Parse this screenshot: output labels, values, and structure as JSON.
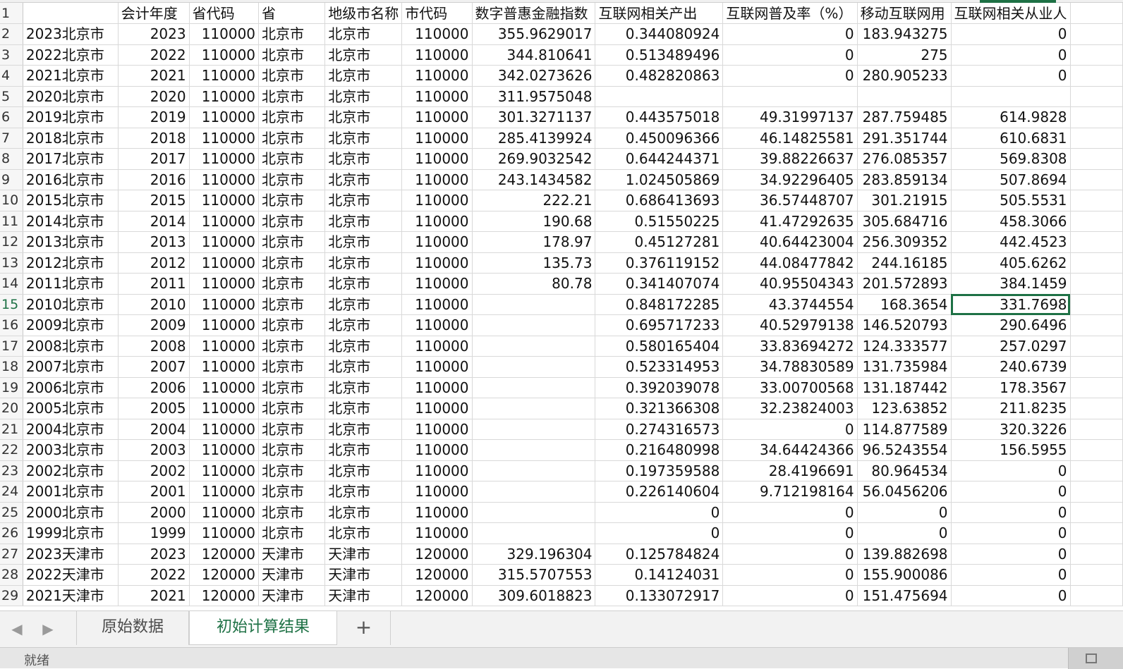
{
  "sheet": {
    "row_numbers": [
      "1",
      "2",
      "3",
      "4",
      "5",
      "6",
      "7",
      "8",
      "9",
      "10",
      "11",
      "12",
      "13",
      "14",
      "15",
      "16",
      "17",
      "18",
      "19",
      "20",
      "21",
      "22",
      "23",
      "24",
      "25",
      "26",
      "27",
      "28",
      "29"
    ],
    "active_row": "15",
    "headers": [
      "",
      "会计年度",
      "省代码",
      "省",
      "地级市名称",
      "市代码",
      "数字普惠金融指数",
      "互联网相关产出",
      "互联网普及率（%）",
      "移动互联网用",
      "互联网相关从业人"
    ],
    "rows": [
      [
        "2023北京市",
        "2023",
        "110000",
        "北京市",
        "北京市",
        "110000",
        "355.9629017",
        "0.344080924",
        "0",
        "183.943275",
        "0"
      ],
      [
        "2022北京市",
        "2022",
        "110000",
        "北京市",
        "北京市",
        "110000",
        "344.810641",
        "0.513489496",
        "0",
        "275",
        "0"
      ],
      [
        "2021北京市",
        "2021",
        "110000",
        "北京市",
        "北京市",
        "110000",
        "342.0273626",
        "0.482820863",
        "0",
        "280.905233",
        "0"
      ],
      [
        "2020北京市",
        "2020",
        "110000",
        "北京市",
        "北京市",
        "110000",
        "311.9575048",
        "",
        "",
        "",
        ""
      ],
      [
        "2019北京市",
        "2019",
        "110000",
        "北京市",
        "北京市",
        "110000",
        "301.3271137",
        "0.443575018",
        "49.31997137",
        "287.759485",
        "614.9828"
      ],
      [
        "2018北京市",
        "2018",
        "110000",
        "北京市",
        "北京市",
        "110000",
        "285.4139924",
        "0.450096366",
        "46.14825581",
        "291.351744",
        "610.6831"
      ],
      [
        "2017北京市",
        "2017",
        "110000",
        "北京市",
        "北京市",
        "110000",
        "269.9032542",
        "0.644244371",
        "39.88226637",
        "276.085357",
        "569.8308"
      ],
      [
        "2016北京市",
        "2016",
        "110000",
        "北京市",
        "北京市",
        "110000",
        "243.1434582",
        "1.024505869",
        "34.92296405",
        "283.859134",
        "507.8694"
      ],
      [
        "2015北京市",
        "2015",
        "110000",
        "北京市",
        "北京市",
        "110000",
        "222.21",
        "0.686413693",
        "36.57448707",
        "301.21915",
        "505.5531"
      ],
      [
        "2014北京市",
        "2014",
        "110000",
        "北京市",
        "北京市",
        "110000",
        "190.68",
        "0.51550225",
        "41.47292635",
        "305.684716",
        "458.3066"
      ],
      [
        "2013北京市",
        "2013",
        "110000",
        "北京市",
        "北京市",
        "110000",
        "178.97",
        "0.45127281",
        "40.64423004",
        "256.309352",
        "442.4523"
      ],
      [
        "2012北京市",
        "2012",
        "110000",
        "北京市",
        "北京市",
        "110000",
        "135.73",
        "0.376119152",
        "44.08477842",
        "244.16185",
        "405.6262"
      ],
      [
        "2011北京市",
        "2011",
        "110000",
        "北京市",
        "北京市",
        "110000",
        "80.78",
        "0.341407074",
        "40.95504343",
        "201.572893",
        "384.1459"
      ],
      [
        "2010北京市",
        "2010",
        "110000",
        "北京市",
        "北京市",
        "110000",
        "",
        "0.848172285",
        "43.3744554",
        "168.3654",
        "331.7698"
      ],
      [
        "2009北京市",
        "2009",
        "110000",
        "北京市",
        "北京市",
        "110000",
        "",
        "0.695717233",
        "40.52979138",
        "146.520793",
        "290.6496"
      ],
      [
        "2008北京市",
        "2008",
        "110000",
        "北京市",
        "北京市",
        "110000",
        "",
        "0.580165404",
        "33.83694272",
        "124.333577",
        "257.0297"
      ],
      [
        "2007北京市",
        "2007",
        "110000",
        "北京市",
        "北京市",
        "110000",
        "",
        "0.523314953",
        "34.78830589",
        "131.735984",
        "240.6739"
      ],
      [
        "2006北京市",
        "2006",
        "110000",
        "北京市",
        "北京市",
        "110000",
        "",
        "0.392039078",
        "33.00700568",
        "131.187442",
        "178.3567"
      ],
      [
        "2005北京市",
        "2005",
        "110000",
        "北京市",
        "北京市",
        "110000",
        "",
        "0.321366308",
        "32.23824003",
        "123.63852",
        "211.8235"
      ],
      [
        "2004北京市",
        "2004",
        "110000",
        "北京市",
        "北京市",
        "110000",
        "",
        "0.274316573",
        "0",
        "114.877589",
        "320.3226"
      ],
      [
        "2003北京市",
        "2003",
        "110000",
        "北京市",
        "北京市",
        "110000",
        "",
        "0.216480998",
        "34.64424366",
        "96.5243554",
        "156.5955"
      ],
      [
        "2002北京市",
        "2002",
        "110000",
        "北京市",
        "北京市",
        "110000",
        "",
        "0.197359588",
        "28.4196691",
        "80.964534",
        "0"
      ],
      [
        "2001北京市",
        "2001",
        "110000",
        "北京市",
        "北京市",
        "110000",
        "",
        "0.226140604",
        "9.712198164",
        "56.0456206",
        "0"
      ],
      [
        "2000北京市",
        "2000",
        "110000",
        "北京市",
        "北京市",
        "110000",
        "",
        "0",
        "0",
        "0",
        "0"
      ],
      [
        "1999北京市",
        "1999",
        "110000",
        "北京市",
        "北京市",
        "110000",
        "",
        "0",
        "0",
        "0",
        "0"
      ],
      [
        "2023天津市",
        "2023",
        "120000",
        "天津市",
        "天津市",
        "120000",
        "329.196304",
        "0.125784824",
        "0",
        "139.882698",
        "0"
      ],
      [
        "2022天津市",
        "2022",
        "120000",
        "天津市",
        "天津市",
        "120000",
        "315.5707553",
        "0.14124031",
        "0",
        "155.900086",
        "0"
      ],
      [
        "2021天津市",
        "2021",
        "120000",
        "天津市",
        "天津市",
        "120000",
        "309.6018823",
        "0.133072917",
        "0",
        "151.475694",
        "0"
      ]
    ],
    "selected_cell_value": "331.7698"
  },
  "tabs": {
    "prev_icon": "triangle-left-icon",
    "next_icon": "triangle-right-icon",
    "items": [
      {
        "label": "原始数据",
        "active": false
      },
      {
        "label": "初始计算结果",
        "active": true
      }
    ],
    "add_label": "+"
  },
  "status": {
    "text": "就绪"
  },
  "colors": {
    "accent": "#1e7145"
  }
}
